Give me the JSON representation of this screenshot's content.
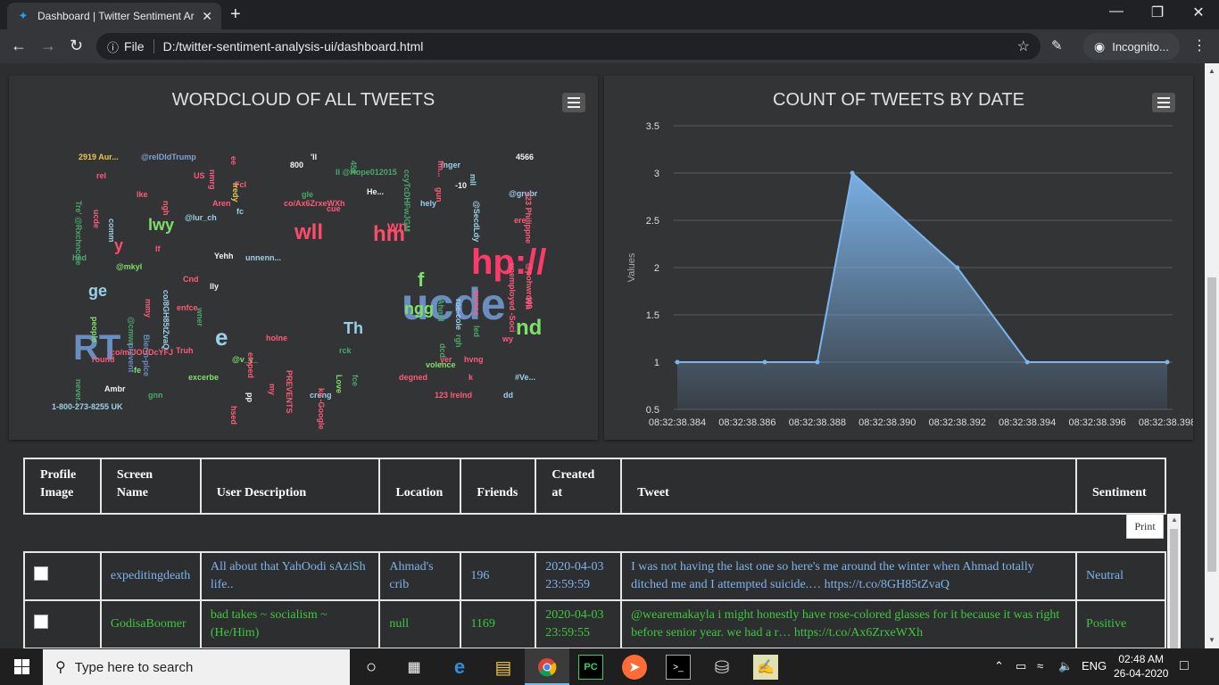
{
  "browser": {
    "tab_title": "Dashboard | Twitter Sentiment Ar",
    "url_scheme": "File",
    "url": "D:/twitter-sentiment-analysis-ui/dashboard.html",
    "profile": "Incognito..."
  },
  "wordcloud": {
    "title": "WORDCLOUD OF ALL TWEETS",
    "words": [
      {
        "t": "2919 Aur...",
        "c": "#e6c84a",
        "s": 9
      },
      {
        "t": "@relDldTrump",
        "c": "#7fa2d4",
        "s": 9
      },
      {
        "t": "Fcl",
        "c": "#ff5a7a",
        "s": 9
      },
      {
        "t": "800",
        "c": "#f2f2f2",
        "s": 9
      },
      {
        "t": "'ll",
        "c": "#f2f2f2",
        "s": 9
      },
      {
        "t": "inger",
        "c": "#9ad0e6",
        "s": 9
      },
      {
        "t": "4566",
        "c": "#f2f2f2",
        "s": 9
      },
      {
        "t": "rel",
        "c": "#ff5a7a",
        "s": 9
      },
      {
        "t": "US",
        "c": "#ff5a7a",
        "s": 9
      },
      {
        "t": "Il @Hope012015",
        "c": "#4aa86b",
        "s": 9
      },
      {
        "t": "He...",
        "c": "#f2f2f2",
        "s": 9
      },
      {
        "t": "-10",
        "c": "#f2f2f2",
        "s": 9
      },
      {
        "t": "@grubr",
        "c": "#9ad0e6",
        "s": 9
      },
      {
        "t": "lke",
        "c": "#ff5a7a",
        "s": 9
      },
      {
        "t": "Aren",
        "c": "#ff5a7a",
        "s": 9
      },
      {
        "t": "co/Ax6ZrxeWXh",
        "c": "#ff5a7a",
        "s": 9
      },
      {
        "t": "hely",
        "c": "#9ad0e6",
        "s": 9
      },
      {
        "t": "gle",
        "c": "#4aa86b",
        "s": 9
      },
      {
        "t": "cue",
        "c": "#ff5a7a",
        "s": 9
      },
      {
        "t": "ere",
        "c": "#ff5a7a",
        "s": 9
      },
      {
        "t": "lwy",
        "c": "#7ee06a",
        "s": 18
      },
      {
        "t": "@lur_ch",
        "c": "#9ad0e6",
        "s": 9
      },
      {
        "t": "fc",
        "c": "#9ad0e6",
        "s": 9
      },
      {
        "t": "wll",
        "c": "#ff4a6a",
        "s": 24
      },
      {
        "t": "hm",
        "c": "#ff4a6a",
        "s": 24
      },
      {
        "t": "wn",
        "c": "#ff4a6a",
        "s": 16
      },
      {
        "t": "y",
        "c": "#ff4a6a",
        "s": 18
      },
      {
        "t": "hp://",
        "c": "#ff3a6a",
        "s": 40
      },
      {
        "t": "lf",
        "c": "#ff5a7a",
        "s": 9
      },
      {
        "t": "hed",
        "c": "#4aa86b",
        "s": 9
      },
      {
        "t": "@mkyl",
        "c": "#7ee06a",
        "s": 9
      },
      {
        "t": "Yehh",
        "c": "#f2f2f2",
        "s": 9
      },
      {
        "t": "unnenn...",
        "c": "#9ad0e6",
        "s": 9
      },
      {
        "t": "f",
        "c": "#7ee06a",
        "s": 22
      },
      {
        "t": "ucde",
        "c": "#6b8ec2",
        "s": 50
      },
      {
        "t": "ge",
        "c": "#9ad0e6",
        "s": 18
      },
      {
        "t": "lly",
        "c": "#f2f2f2",
        "s": 9
      },
      {
        "t": "enfce",
        "c": "#ff5a7a",
        "s": 9
      },
      {
        "t": "e",
        "c": "#9ad0e6",
        "s": 26
      },
      {
        "t": "Th",
        "c": "#9ad0e6",
        "s": 18
      },
      {
        "t": "ngg",
        "c": "#7ee06a",
        "s": 18
      },
      {
        "t": "nd",
        "c": "#7ee06a",
        "s": 24
      },
      {
        "t": "RT",
        "c": "#6b8ec2",
        "s": 40
      },
      {
        "t": "co/mlJOUDcYFJ",
        "c": "#ff5a7a",
        "s": 9
      },
      {
        "t": "Truh",
        "c": "#ff5a7a",
        "s": 9
      },
      {
        "t": "wy",
        "c": "#ff5a7a",
        "s": 9
      },
      {
        "t": "round",
        "c": "#ff5a7a",
        "s": 9
      },
      {
        "t": "@v_y_",
        "c": "#7ee06a",
        "s": 9
      },
      {
        "t": "rck",
        "c": "#4aa86b",
        "s": 9
      },
      {
        "t": "yer",
        "c": "#ff5a7a",
        "s": 9
      },
      {
        "t": "hvng",
        "c": "#ff5a7a",
        "s": 9
      },
      {
        "t": "fe",
        "c": "#7ee06a",
        "s": 9
      },
      {
        "t": "excerbe",
        "c": "#7ee06a",
        "s": 9
      },
      {
        "t": "volence",
        "c": "#7ee06a",
        "s": 9
      },
      {
        "t": "degned",
        "c": "#ff5a7a",
        "s": 9
      },
      {
        "t": "k",
        "c": "#ff5a7a",
        "s": 9
      },
      {
        "t": "#Ve...",
        "c": "#9ad0e6",
        "s": 9
      },
      {
        "t": "Ambr",
        "c": "#f2f2f2",
        "s": 9
      },
      {
        "t": "gnn",
        "c": "#4aa86b",
        "s": 9
      },
      {
        "t": "creng",
        "c": "#9ad0e6",
        "s": 9
      },
      {
        "t": "123 lreInd",
        "c": "#ff5a7a",
        "s": 9
      },
      {
        "t": "dd",
        "c": "#9ad0e6",
        "s": 9
      },
      {
        "t": "1-800-273-8255 UK",
        "c": "#9ad0e6",
        "s": 9
      },
      {
        "t": "Cnd",
        "c": "#ff5a7a",
        "s": 9
      },
      {
        "t": "holne",
        "c": "#ff5a7a",
        "s": 9
      },
      {
        "t": "co/556M8hDj9p",
        "c": "#4aa86b",
        "s": 9
      },
      {
        "t": "116",
        "c": "#9ad0e6",
        "s": 16
      },
      {
        "t": "le",
        "c": "#9ad0e6",
        "s": 16
      }
    ],
    "vwords": [
      {
        "t": "Tre' @Rxchncole",
        "c": "#4aa86b",
        "s": 9
      },
      {
        "t": "comm",
        "c": "#9ad0e6",
        "s": 9
      },
      {
        "t": "ucde",
        "c": "#ff5a7a",
        "s": 9
      },
      {
        "t": "ngh",
        "c": "#ff5a7a",
        "s": 9
      },
      {
        "t": "lredy",
        "c": "#e6c84a",
        "s": 9
      },
      {
        "t": "nmrg",
        "c": "#ff5a7a",
        "s": 9
      },
      {
        "t": "ee",
        "c": "#ff5a7a",
        "s": 9
      },
      {
        "t": "456",
        "c": "#4aa86b",
        "s": 9
      },
      {
        "t": "ccyTcDHFwJGM",
        "c": "#4aa86b",
        "s": 9
      },
      {
        "t": "fm...",
        "c": "#ff5a7a",
        "s": 9
      },
      {
        "t": "mll",
        "c": "#9ad0e6",
        "s": 9
      },
      {
        "t": "gun",
        "c": "#ff5a7a",
        "s": 9
      },
      {
        "t": "@SecdLdy",
        "c": "#9ad0e6",
        "s": 9
      },
      {
        "t": "123 Philippne",
        "c": "#ff5a7a",
        "s": 9
      },
      {
        "t": "unemployed -Soci",
        "c": "#ff5a7a",
        "s": 9
      },
      {
        "t": "@pohwrd40",
        "c": "#ff5a7a",
        "s": 9
      },
      {
        "t": "Wh",
        "c": "#ff5a7a",
        "s": 9
      },
      {
        "t": "co/8GH85tZvaQ",
        "c": "#9ad0e6",
        "s": 9
      },
      {
        "t": "people",
        "c": "#7ee06a",
        "s": 9
      },
      {
        "t": "@cmwr",
        "c": "#4aa86b",
        "s": 9
      },
      {
        "t": "Bier-n-plce",
        "c": "#6b8ec2",
        "s": 9
      },
      {
        "t": "prevent",
        "c": "#6b8ec2",
        "s": 9
      },
      {
        "t": "mmy",
        "c": "#ff5a7a",
        "s": 9
      },
      {
        "t": "wner",
        "c": "#4aa86b",
        "s": 9
      },
      {
        "t": "roe-cole",
        "c": "#9ad0e6",
        "s": 9
      },
      {
        "t": "munce",
        "c": "#ff5a7a",
        "s": 9
      },
      {
        "t": "Ahmd",
        "c": "#4aa86b",
        "s": 9
      },
      {
        "t": "rgh",
        "c": "#4aa86b",
        "s": 9
      },
      {
        "t": "led",
        "c": "#4aa86b",
        "s": 9
      },
      {
        "t": "PREVENTS",
        "c": "#ff5a7a",
        "s": 9
      },
      {
        "t": "ke -Google",
        "c": "#ff5a7a",
        "s": 9
      },
      {
        "t": "Love",
        "c": "#7ee06a",
        "s": 9
      },
      {
        "t": "fce",
        "c": "#4aa86b",
        "s": 9
      },
      {
        "t": "never...",
        "c": "#4aa86b",
        "s": 9
      },
      {
        "t": "emped",
        "c": "#ff5a7a",
        "s": 9
      },
      {
        "t": "pp",
        "c": "#f2f2f2",
        "s": 9
      },
      {
        "t": "hsed",
        "c": "#ff5a7a",
        "s": 9
      },
      {
        "t": "my",
        "c": "#ff5a7a",
        "s": 9
      },
      {
        "t": "dcd",
        "c": "#4aa86b",
        "s": 9
      }
    ]
  },
  "chart_data": {
    "type": "area",
    "title": "COUNT OF TWEETS BY DATE",
    "ylabel": "Values",
    "xlabel": "",
    "x": [
      "08:32:38.384",
      "08:32:38.3865",
      "08:32:38.388",
      "08:32:38.389",
      "08:32:38.392",
      "08:32:38.394",
      "08:32:38.398"
    ],
    "y": [
      1,
      1,
      1,
      3,
      2,
      1,
      1
    ],
    "x_ticks": [
      "08:32:38.384",
      "08:32:38.386",
      "08:32:38.388",
      "08:32:38.390",
      "08:32:38.392",
      "08:32:38.394",
      "08:32:38.396",
      "08:32:38.398"
    ],
    "y_ticks": [
      "0.5",
      "1",
      "1.5",
      "2",
      "2.5",
      "3",
      "3.5"
    ],
    "ylim": [
      0.5,
      3.5
    ],
    "color": "#7cb5ec",
    "grid": true
  },
  "table": {
    "headers": [
      [
        "Profile",
        "Image"
      ],
      [
        "Screen",
        "Name"
      ],
      [
        "",
        "User Description"
      ],
      [
        "",
        "Location"
      ],
      [
        "",
        "Friends"
      ],
      [
        "Created",
        "at"
      ],
      [
        "",
        "Tweet"
      ],
      [
        "",
        "Sentiment"
      ]
    ],
    "print_label": "Print",
    "rows": [
      {
        "screen_name": "expeditingdeath",
        "description": "All about that YahOodi sAziSh life..",
        "location": "Ahmad's crib",
        "friends": "196",
        "created": "2020-04-03 23:59:59",
        "tweet": "I was not having the last one so here's me around the winter when Ahmad totally ditched me and I attempted suicide.… https://t.co/8GH85tZvaQ",
        "sentiment": "Neutral"
      },
      {
        "screen_name": "GodisaBoomer",
        "description": "bad takes ~ socialism ~ (He/Him)",
        "location": "null",
        "friends": "1169",
        "created": "2020-04-03 23:59:55",
        "tweet": "@wearemakayla i might honestly have rose-colored glasses for it because it was right before senior year. we had a r… https://t.co/Ax6ZrxeWXh",
        "sentiment": "Positive"
      }
    ]
  },
  "taskbar": {
    "search_placeholder": "Type here to search",
    "lang": "ENG",
    "time": "02:48 AM",
    "date": "26-04-2020"
  }
}
